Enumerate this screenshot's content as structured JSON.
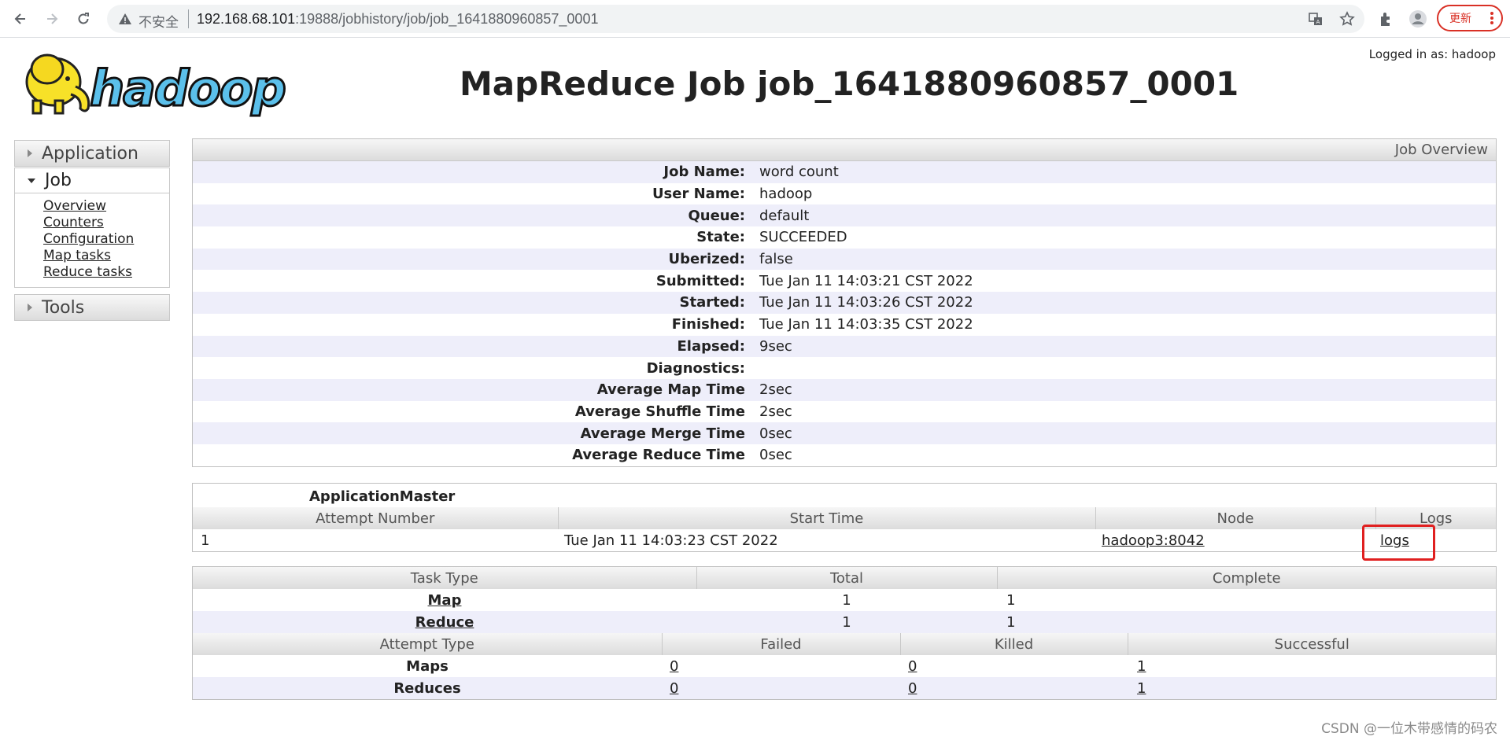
{
  "browser": {
    "insecure_label": "不安全",
    "url_host": "192.168.68.101",
    "url_rest": ":19888/jobhistory/job/job_1641880960857_0001",
    "update_label": "更新"
  },
  "header": {
    "logged_in": "Logged in as: hadoop",
    "logo_text": "hadoop",
    "title": "MapReduce Job job_1641880960857_0001"
  },
  "sidebar": {
    "application": "Application",
    "job": "Job",
    "job_links": [
      "Overview",
      "Counters",
      "Configuration",
      "Map tasks",
      "Reduce tasks"
    ],
    "tools": "Tools"
  },
  "overview": {
    "heading": "Job Overview",
    "rows": [
      {
        "label": "Job Name:",
        "value": "word count"
      },
      {
        "label": "User Name:",
        "value": "hadoop"
      },
      {
        "label": "Queue:",
        "value": "default"
      },
      {
        "label": "State:",
        "value": "SUCCEEDED"
      },
      {
        "label": "Uberized:",
        "value": "false"
      },
      {
        "label": "Submitted:",
        "value": "Tue Jan 11 14:03:21 CST 2022"
      },
      {
        "label": "Started:",
        "value": "Tue Jan 11 14:03:26 CST 2022"
      },
      {
        "label": "Finished:",
        "value": "Tue Jan 11 14:03:35 CST 2022"
      },
      {
        "label": "Elapsed:",
        "value": "9sec"
      },
      {
        "label": "Diagnostics:",
        "value": ""
      },
      {
        "label": "Average Map Time",
        "value": "2sec"
      },
      {
        "label": "Average Shuffle Time",
        "value": "2sec"
      },
      {
        "label": "Average Merge Time",
        "value": "0sec"
      },
      {
        "label": "Average Reduce Time",
        "value": "0sec"
      }
    ]
  },
  "app_master": {
    "caption": "ApplicationMaster",
    "headers": [
      "Attempt Number",
      "Start Time",
      "Node",
      "Logs"
    ],
    "row": {
      "attempt": "1",
      "start_time": "Tue Jan 11 14:03:23 CST 2022",
      "node": "hadoop3:8042",
      "logs": "logs"
    }
  },
  "tasks": {
    "headers": [
      "Task Type",
      "Total",
      "Complete"
    ],
    "rows": [
      {
        "type": "Map",
        "total": "1",
        "complete": "1"
      },
      {
        "type": "Reduce",
        "total": "1",
        "complete": "1"
      }
    ]
  },
  "attempts": {
    "headers": [
      "Attempt Type",
      "Failed",
      "Killed",
      "Successful"
    ],
    "rows": [
      {
        "type": "Maps",
        "failed": "0",
        "killed": "0",
        "successful": "1"
      },
      {
        "type": "Reduces",
        "failed": "0",
        "killed": "0",
        "successful": "1"
      }
    ]
  },
  "watermark": "CSDN @一位木带感情的码农",
  "colors": {
    "stripe": "#eeeefa",
    "highlight": "#e02020",
    "update": "#d93025",
    "logo_yellow": "#f7e128",
    "logo_blue": "#5bc0eb"
  }
}
